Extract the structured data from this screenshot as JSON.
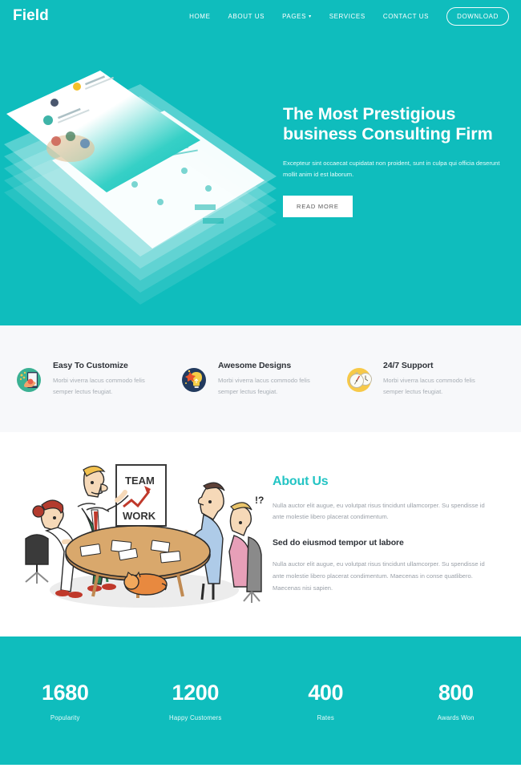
{
  "theme": {
    "teal": "#0FBDBD",
    "teal_accent": "#23C4C4",
    "features_bg": "#F7F8FA",
    "heading_color": "#2E3238",
    "muted_text": "#9AA0A8"
  },
  "navbar": {
    "logo": "Field",
    "links": [
      {
        "label": "HOME",
        "has_caret": false
      },
      {
        "label": "ABOUT US",
        "has_caret": false
      },
      {
        "label": "PAGES",
        "has_caret": true
      },
      {
        "label": "SERVICES",
        "has_caret": false
      },
      {
        "label": "CONTACT US",
        "has_caret": false
      }
    ],
    "caret_glyph": "▾",
    "download_label": "DOWNLOAD"
  },
  "hero": {
    "title_line1": "The Most Prestigious",
    "title_line2": "business Consulting Firm",
    "subtitle": "Excepteur sint occaecat cupidatat non proident, sunt in culpa qui officia deserunt mollit anim id est laborum.",
    "button_label": "READ MORE",
    "illustration_name": "stacked-website-mockups"
  },
  "features": [
    {
      "icon": "hand-tablet-icon",
      "title": "Easy To Customize",
      "text": "Morbi viverra lacus commodo felis semper lectus feugiat."
    },
    {
      "icon": "lightbulb-idea-icon",
      "title": "Awesome Designs",
      "text": "Morbi viverra lacus commodo felis semper lectus feugiat."
    },
    {
      "icon": "stopwatch-clock-icon",
      "title": "24/7 Support",
      "text": "Morbi viverra lacus commodo felis semper lectus feugiat."
    }
  ],
  "about": {
    "illustration_name": "team-meeting-cartoon",
    "flipchart_top": "TEAM",
    "flipchart_bottom": "WORK",
    "title": "About Us",
    "paragraph1": "Nulla auctor elit augue, eu volutpat risus tincidunt ullamcorper. Su spendisse id ante molestie libero placerat condimentum.",
    "subtitle": "Sed do eiusmod tempor ut labore",
    "paragraph2": "Nulla auctor elit augue, eu volutpat risus tincidunt ullamcorper. Su spendisse id ante molestie libero placerat condimentum. Maecenas in conse quatlibero. Maecenas nisi sapien."
  },
  "counters": [
    {
      "number": "1680",
      "label": "Popularity"
    },
    {
      "number": "1200",
      "label": "Happy Customers"
    },
    {
      "number": "400",
      "label": "Rates"
    },
    {
      "number": "800",
      "label": "Awards Won"
    }
  ]
}
